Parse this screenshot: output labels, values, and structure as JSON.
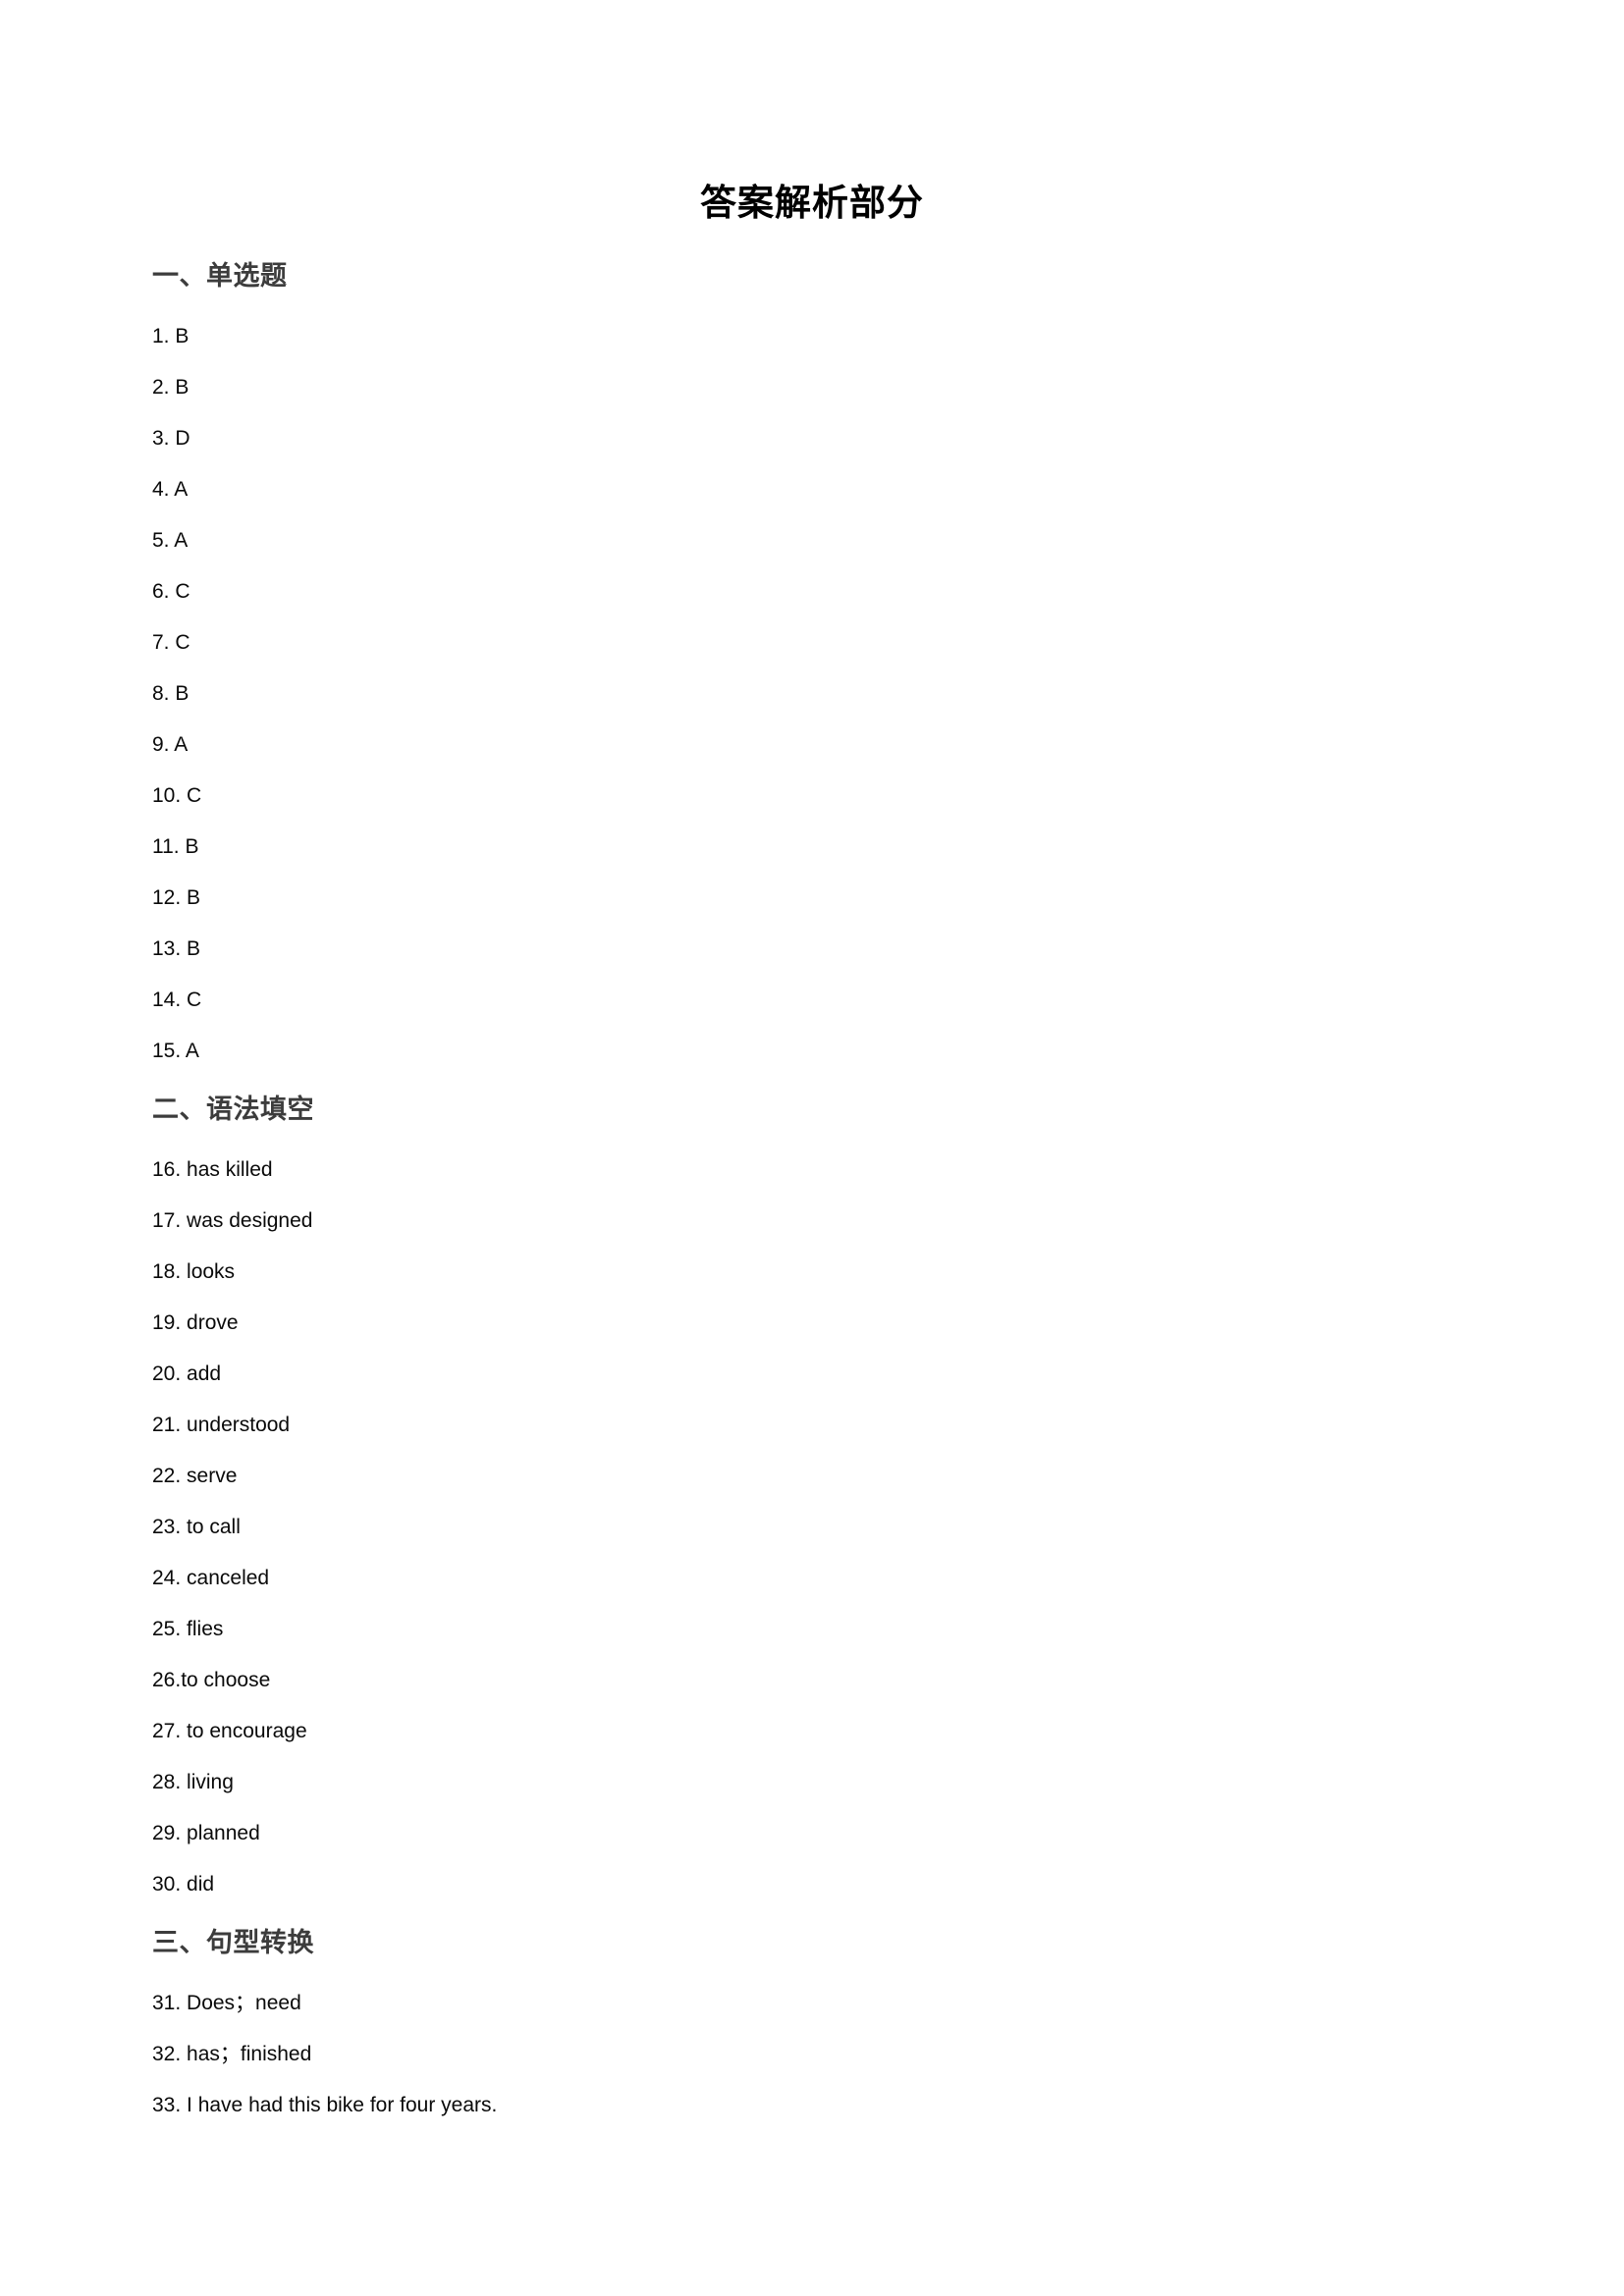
{
  "document": {
    "title": "答案解析部分",
    "background_color": "#ffffff",
    "text_color": "#0a0a0a",
    "heading_color": "#3c3c3c"
  },
  "sections": [
    {
      "heading": "一、单选题",
      "items": [
        "1. B",
        "2. B",
        "3. D",
        "4. A",
        "5. A",
        "6. C",
        "7. C",
        "8. B",
        "9. A",
        "10. C",
        "11. B",
        "12. B",
        "13. B",
        "14. C",
        "15. A"
      ]
    },
    {
      "heading": "二、语法填空",
      "items": [
        "16. has killed",
        "17. was designed",
        "18. looks",
        "19. drove",
        "20. add",
        "21. understood",
        "22. serve",
        "23. to call",
        "24. canceled",
        "25. flies",
        "26.to choose",
        "27. to encourage",
        "28. living",
        "29. planned",
        "30. did"
      ]
    },
    {
      "heading": "三、句型转换",
      "items": [
        "31. Does；need",
        "32. has；finished",
        "33. I have had this bike for four years."
      ]
    }
  ]
}
